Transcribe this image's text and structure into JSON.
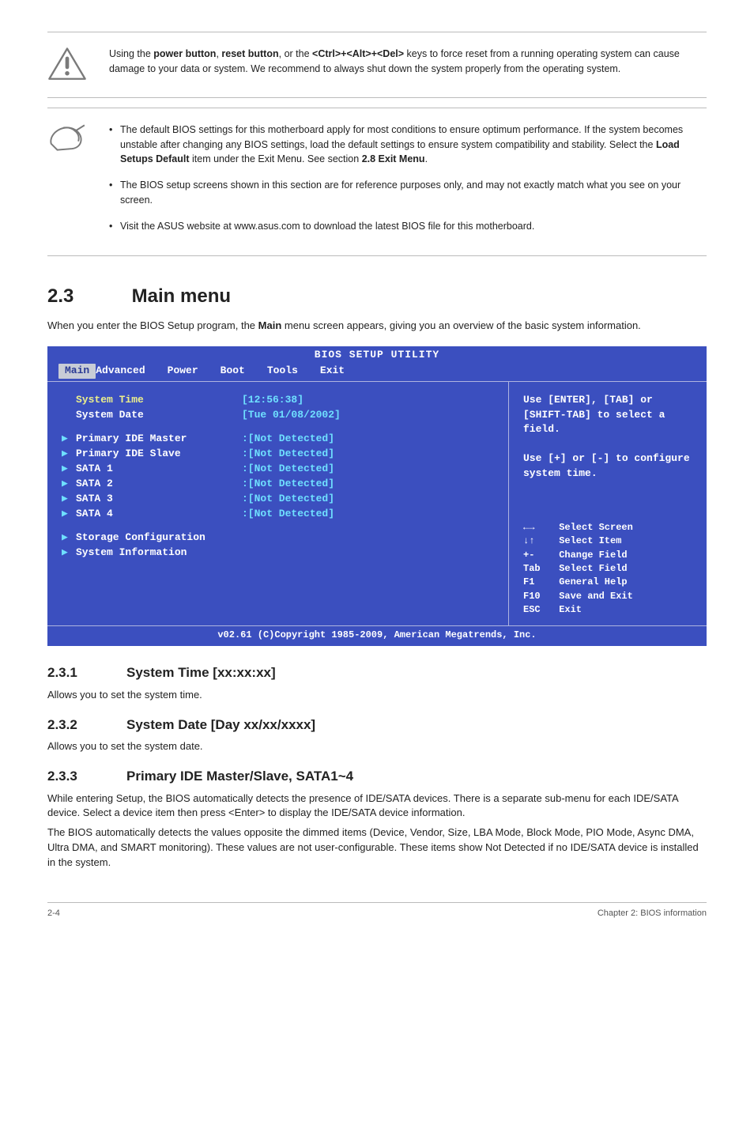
{
  "callout_warn": "Using the <b>power button</b>, <b>reset button</b>, or the <b>&lt;Ctrl&gt;+&lt;Alt&gt;+&lt;Del&gt;</b> keys to force reset from a running operating system can cause damage to your data or system. We recommend to always shut down the system properly from the operating system.",
  "callout_notes": [
    "The default BIOS settings for this motherboard apply for most conditions to ensure optimum performance. If the system becomes unstable after changing any BIOS settings, load the default settings to ensure system compatibility and stability. Select the <b>Load Setups Default</b> item under the Exit Menu. See section <b>2.8 Exit Menu</b>.",
    "The BIOS setup screens shown in this section are for reference purposes only, and may not exactly match what you see on your screen.",
    "Visit the ASUS website at www.asus.com to download the latest BIOS file for this motherboard."
  ],
  "section": {
    "num": "2.3",
    "title": "Main menu"
  },
  "lead": "When you enter the BIOS Setup program, the <b>Main</b> menu screen appears, giving you an overview of the basic system information.",
  "bios": {
    "title": "BIOS SETUP UTILITY",
    "tabs": [
      "Main",
      "Advanced",
      "Power",
      "Boot",
      "Tools",
      "Exit"
    ],
    "left_rows": [
      {
        "arrow": "",
        "label": "System Time",
        "yellow": true,
        "value": "[12:56:38]"
      },
      {
        "arrow": "",
        "label": "System Date",
        "yellow": false,
        "value": "[Tue 01/08/2002]"
      },
      {
        "spacer": true
      },
      {
        "arrow": "▶",
        "label": "Primary IDE Master",
        "value": ":[Not Detected]"
      },
      {
        "arrow": "▶",
        "label": "Primary IDE Slave",
        "value": ":[Not Detected]"
      },
      {
        "arrow": "▶",
        "label": "SATA 1",
        "value": ":[Not Detected]"
      },
      {
        "arrow": "▶",
        "label": "SATA 2",
        "value": ":[Not Detected]"
      },
      {
        "arrow": "▶",
        "label": "SATA 3",
        "value": ":[Not Detected]"
      },
      {
        "arrow": "▶",
        "label": "SATA 4",
        "value": ":[Not Detected]"
      },
      {
        "spacer": true
      },
      {
        "arrow": "▶",
        "label": "Storage Configuration",
        "value": ""
      },
      {
        "arrow": "▶",
        "label": "System Information",
        "value": ""
      }
    ],
    "help1": "Use [ENTER], [TAB] or [SHIFT-TAB] to select a field.",
    "help2": "Use [+] or [-] to configure system time.",
    "nav": [
      {
        "k": "←→",
        "t": "Select Screen"
      },
      {
        "k": "↓↑",
        "t": "Select Item"
      },
      {
        "k": "+-",
        "t": "Change Field"
      },
      {
        "k": "Tab",
        "t": "Select Field"
      },
      {
        "k": "F1",
        "t": "General Help"
      },
      {
        "k": "F10",
        "t": "Save and Exit"
      },
      {
        "k": "ESC",
        "t": "Exit"
      }
    ],
    "footer": "v02.61 (C)Copyright 1985-2009, American Megatrends, Inc."
  },
  "subs": [
    {
      "n": "2.3.1",
      "t": "System Time [xx:xx:xx]",
      "body": [
        "Allows you to set the system time."
      ]
    },
    {
      "n": "2.3.2",
      "t": "System Date [Day xx/xx/xxxx]",
      "body": [
        "Allows you to set the system date."
      ]
    },
    {
      "n": "2.3.3",
      "t": "Primary IDE Master/Slave, SATA1~4",
      "body": [
        "While entering Setup, the BIOS automatically detects the presence of IDE/SATA devices. There is a separate sub-menu for each IDE/SATA device. Select a device item then press &lt;Enter&gt; to display the IDE/SATA device information.",
        "The BIOS automatically detects the values opposite the dimmed items (Device, Vendor, Size, LBA Mode, Block Mode, PIO Mode, Async DMA, Ultra DMA, and SMART monitoring). These values are not user-configurable. These items show Not Detected if no IDE/SATA device is installed in the system."
      ]
    }
  ],
  "footer": {
    "left": "2-4",
    "right": "Chapter 2: BIOS information"
  }
}
